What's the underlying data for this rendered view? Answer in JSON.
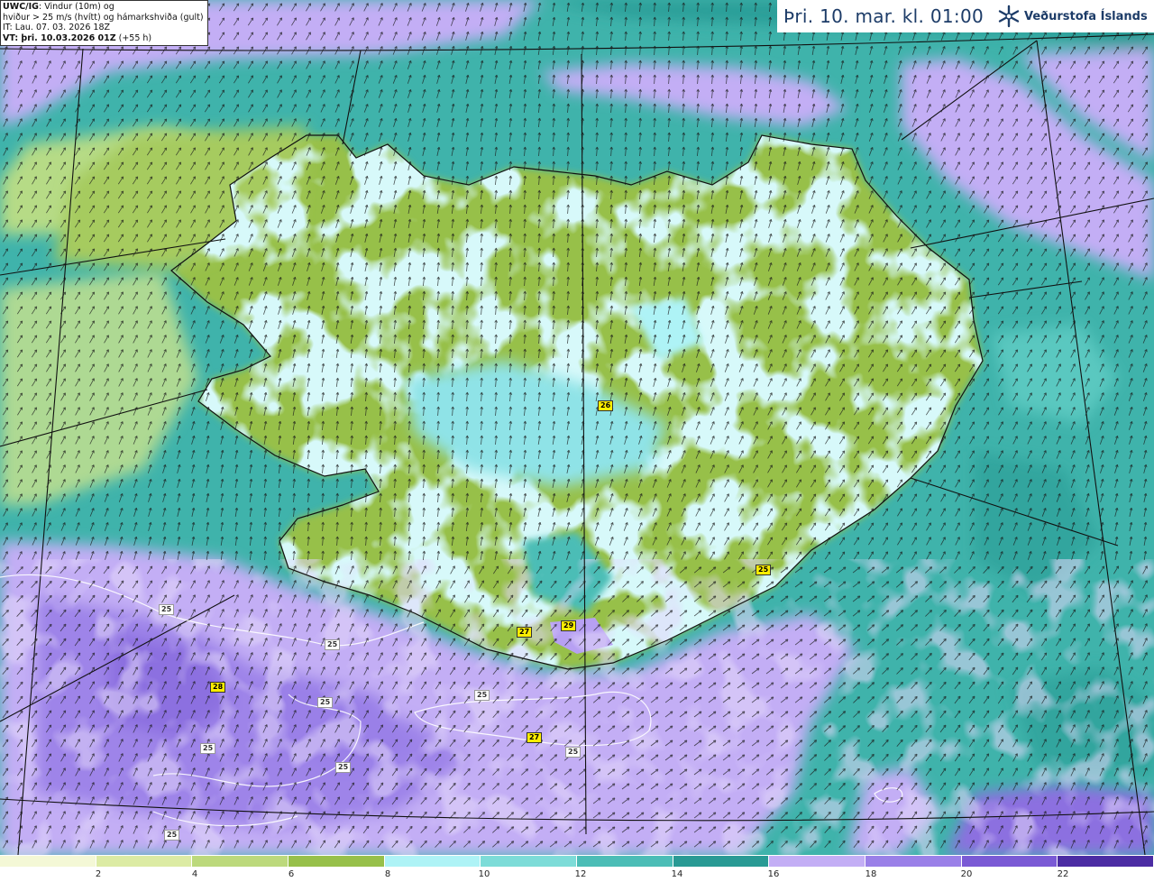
{
  "info": {
    "model_label": "UWC/IG",
    "line1": ": Vindur (10m) og",
    "line2": "hviður > 25 m/s (hvítt) og hámarkshviða (gult)",
    "line3": "IT: Lau. 07. 03. 2026 18Z",
    "vt_label": "VT: þri. 10.03.2026 01Z",
    "vt_lead": " (+55 h)"
  },
  "header": {
    "valid_time": "Þri. 10. mar. kl. 01:00",
    "brand_name": "Veðurstofa Íslands",
    "brand_icon": "snowflake-logo"
  },
  "legend": {
    "ticks": [
      "2",
      "4",
      "6",
      "8",
      "10",
      "12",
      "14",
      "16",
      "18",
      "20",
      "22"
    ],
    "colors": [
      "#f4f8d6",
      "#dceba4",
      "#bcd97c",
      "#97c04a",
      "#aef3f6",
      "#7ddcd8",
      "#4bbdb6",
      "#299a94",
      "#c3aef5",
      "#9a80e8",
      "#7a5ad5",
      "#4b2ca3"
    ]
  },
  "gust_labels": {
    "yellow": [
      "26",
      "25",
      "27",
      "29",
      "28",
      "27"
    ],
    "white": [
      "25",
      "25",
      "25",
      "25",
      "25",
      "25",
      "25",
      "25"
    ]
  }
}
